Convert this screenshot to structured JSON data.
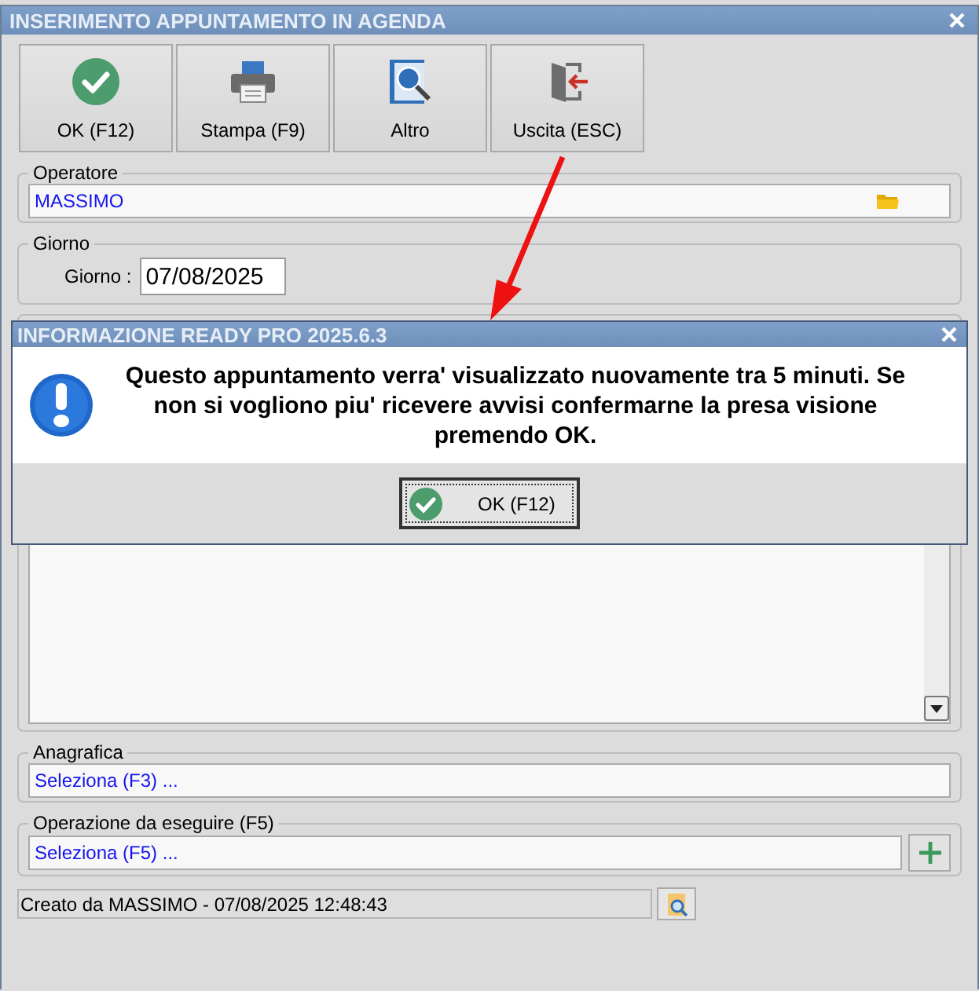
{
  "window": {
    "title": "INSERIMENTO APPUNTAMENTO IN AGENDA"
  },
  "toolbar": [
    {
      "label": "OK (F12)",
      "kind": "ok"
    },
    {
      "label": "Stampa (F9)",
      "kind": "print"
    },
    {
      "label": "Altro",
      "kind": "search"
    },
    {
      "label": "Uscita (ESC)",
      "kind": "exit"
    }
  ],
  "operatore": {
    "legend": "Operatore",
    "value": "MASSIMO"
  },
  "giorno": {
    "legend": "Giorno",
    "label": "Giorno :",
    "value": "07/08/2025"
  },
  "anagrafica": {
    "legend": "Anagrafica",
    "value": "Seleziona (F3) ..."
  },
  "operazione": {
    "legend": "Operazione da eseguire (F5)",
    "value": "Seleziona (F5) ..."
  },
  "status": "Creato da MASSIMO - 07/08/2025 12:48:43",
  "dialog": {
    "title": "INFORMAZIONE READY PRO 2025.6.3",
    "message": "Questo appuntamento verra' visualizzato nuovamente tra 5 minuti. Se non si vogliono piu' ricevere avvisi confermarne la presa visione premendo OK.",
    "button": "OK (F12)"
  }
}
